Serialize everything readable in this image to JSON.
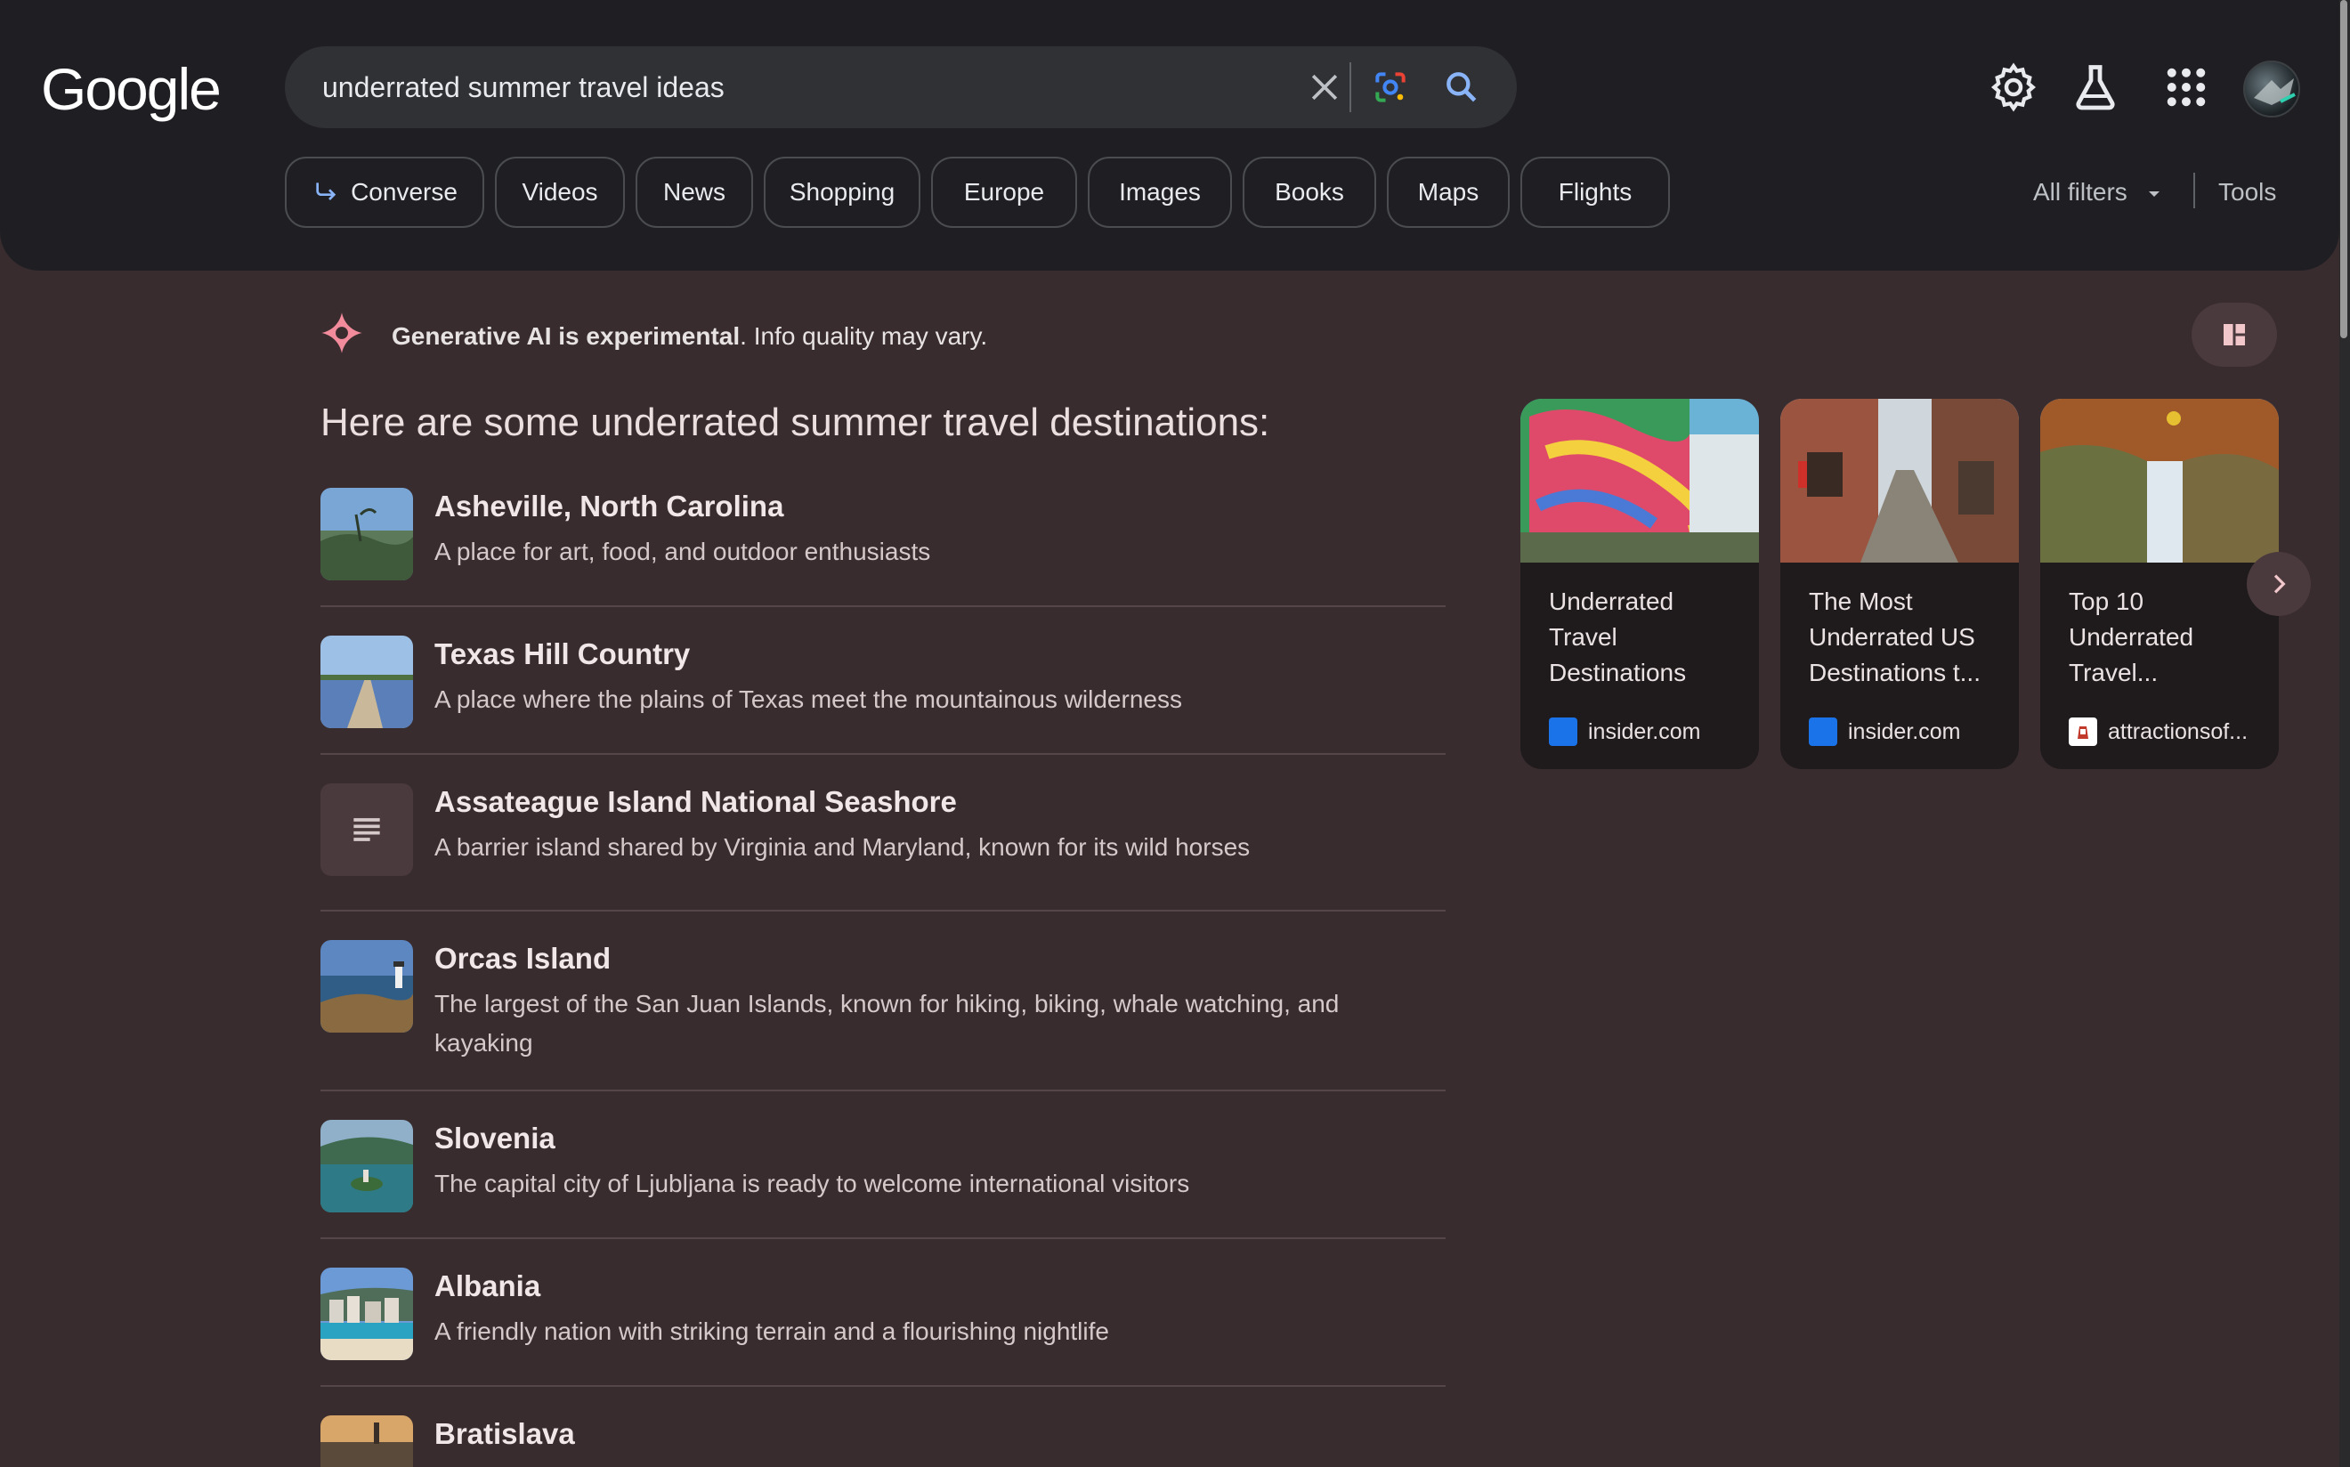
{
  "header": {
    "logo": "Google",
    "search": {
      "query": "underrated summer travel ideas"
    },
    "icons": [
      "settings-icon",
      "labs-flask-icon",
      "apps-grid-icon",
      "account-avatar"
    ],
    "chips": [
      "Converse",
      "Videos",
      "News",
      "Shopping",
      "Europe",
      "Images",
      "Books",
      "Maps",
      "Flights"
    ],
    "all_filters": "All filters",
    "tools": "Tools"
  },
  "ai": {
    "notice_bold": "Generative AI is experimental",
    "notice_rest": ". Info quality may vary.",
    "headline": "Here are some underrated summer travel destinations:"
  },
  "items": [
    {
      "title": "Asheville, North Carolina",
      "desc": "A place for art, food, and outdoor enthusiasts"
    },
    {
      "title": "Texas Hill Country",
      "desc": "A place where the plains of Texas meet the mountainous wilderness"
    },
    {
      "title": "Assateague Island National Seashore",
      "desc": "A barrier island shared by Virginia and Maryland, known for its wild horses"
    },
    {
      "title": "Orcas Island",
      "desc": "The largest of the San Juan Islands, known for hiking, biking, whale watching, and kayaking"
    },
    {
      "title": "Slovenia",
      "desc": "The capital city of Ljubljana is ready to welcome international visitors"
    },
    {
      "title": "Albania",
      "desc": "A friendly nation with striking terrain and a flourishing nightlife"
    },
    {
      "title": "Bratislava",
      "desc": ""
    }
  ],
  "cards": [
    {
      "title": "Underrated Travel Destinations",
      "source": "insider.com"
    },
    {
      "title": "The Most Underrated US Destinations t...",
      "source": "insider.com"
    },
    {
      "title": "Top 10 Underrated Travel...",
      "source": "attractionsof..."
    }
  ],
  "colors": {
    "header_bg": "#1f1f23",
    "page_bg": "#382c2f",
    "ai_accent": "#f28b9b",
    "insider_blue": "#1a73e8"
  }
}
